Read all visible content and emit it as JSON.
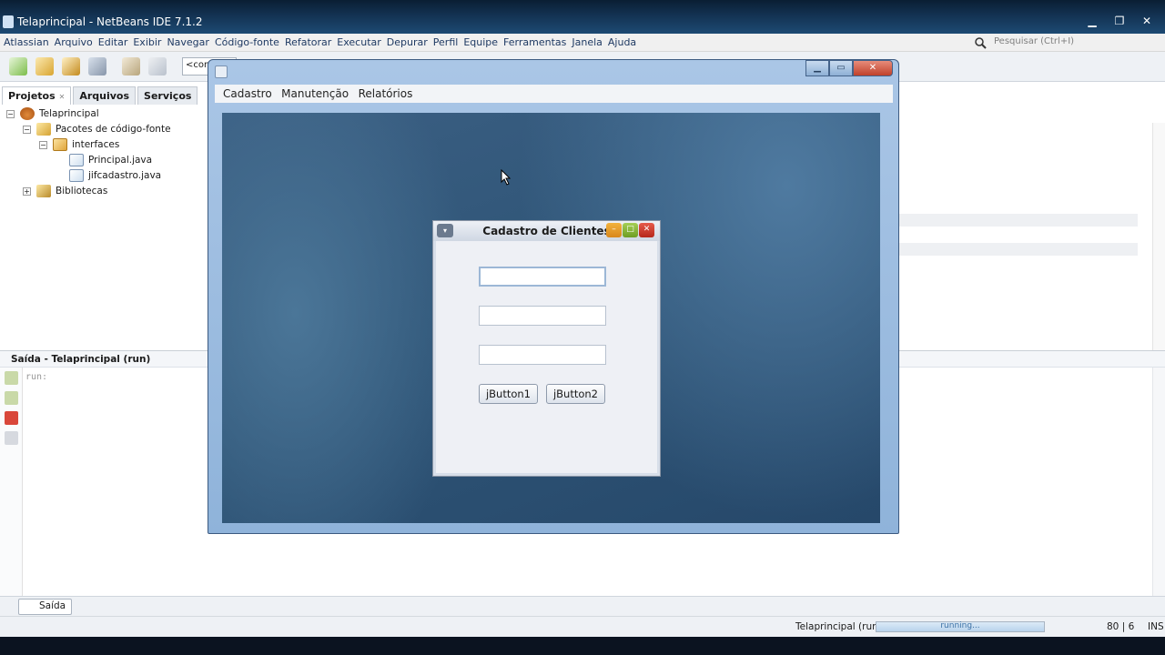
{
  "ide": {
    "title": "Telaprincipal - NetBeans IDE 7.1.2",
    "window_buttons": {
      "minimize": "▁",
      "restore": "❐",
      "close": "✕"
    },
    "menu": [
      "Atlassian",
      "Arquivo",
      "Editar",
      "Exibir",
      "Navegar",
      "Código-fonte",
      "Refatorar",
      "Executar",
      "Depurar",
      "Perfil",
      "Equipe",
      "Ferramentas",
      "Janela",
      "Ajuda"
    ],
    "search_placeholder": "Pesquisar (Ctrl+I)",
    "toolbar_combo": "<con",
    "colors": {
      "accent": "#1f3a63",
      "titlebar": "#12304f"
    }
  },
  "projects": {
    "tabs": [
      "Projetos",
      "Arquivos",
      "Serviços"
    ],
    "tab_close": "✕",
    "tree": [
      {
        "label": "Telaprincipal",
        "icon": "coffee-cup-icon",
        "expander": "−"
      },
      {
        "label": "Pacotes de código-fonte",
        "icon": "source-packages-icon",
        "expander": "−"
      },
      {
        "label": "interfaces",
        "icon": "package-icon",
        "expander": "−"
      },
      {
        "label": "Principal.java",
        "icon": "java-file-icon",
        "expander": ""
      },
      {
        "label": "jifcadastro.java",
        "icon": "java-file-icon",
        "expander": ""
      },
      {
        "label": "Bibliotecas",
        "icon": "libraries-icon",
        "expander": "+"
      }
    ]
  },
  "output": {
    "title": "Saída - Telaprincipal (run)",
    "text": "run:"
  },
  "dock": {
    "output_button": "Saída"
  },
  "status": {
    "process": "Telaprincipal (run)",
    "progress_text": "running...",
    "position": "80 | 6",
    "mode": "INS"
  },
  "app": {
    "menu": [
      "Cadastro",
      "Manutenção",
      "Relatórios"
    ],
    "window_buttons": {
      "minimize": "▁",
      "maximize": "▭",
      "close": "✕"
    },
    "internal_frame": {
      "title": "Cadastro de Clientes",
      "fields": [
        "",
        "",
        ""
      ],
      "buttons": [
        "jButton1",
        "jButton2"
      ],
      "system_menu": "▾",
      "frame_buttons": {
        "minimize": "–",
        "maximize": "□",
        "close": "✕"
      }
    }
  }
}
